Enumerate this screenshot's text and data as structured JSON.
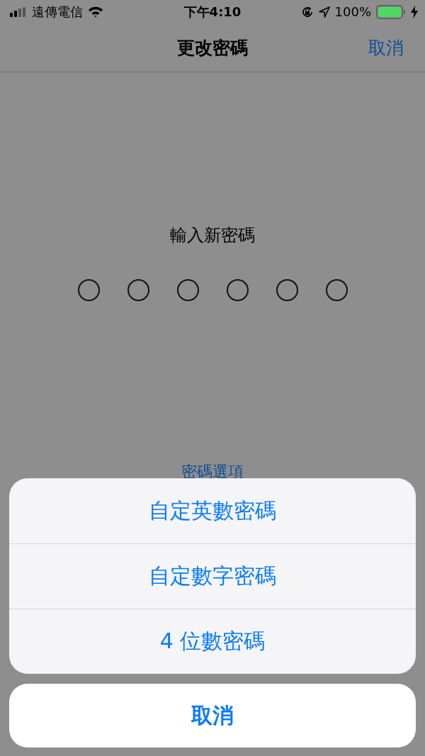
{
  "status_bar": {
    "carrier": "遠傳電信",
    "time": "下午4:10",
    "battery": "100%"
  },
  "nav": {
    "title": "更改密碼",
    "cancel": "取消"
  },
  "prompt": "輸入新密碼",
  "dots": [
    {
      "filled": false
    },
    {
      "filled": false
    },
    {
      "filled": false
    },
    {
      "filled": false
    },
    {
      "filled": false
    },
    {
      "filled": false
    }
  ],
  "options_link": "密碼選項",
  "action_sheet": {
    "options": [
      "自定英數密碼",
      "自定數字密碼",
      "4 位數密碼"
    ],
    "cancel": "取消"
  }
}
